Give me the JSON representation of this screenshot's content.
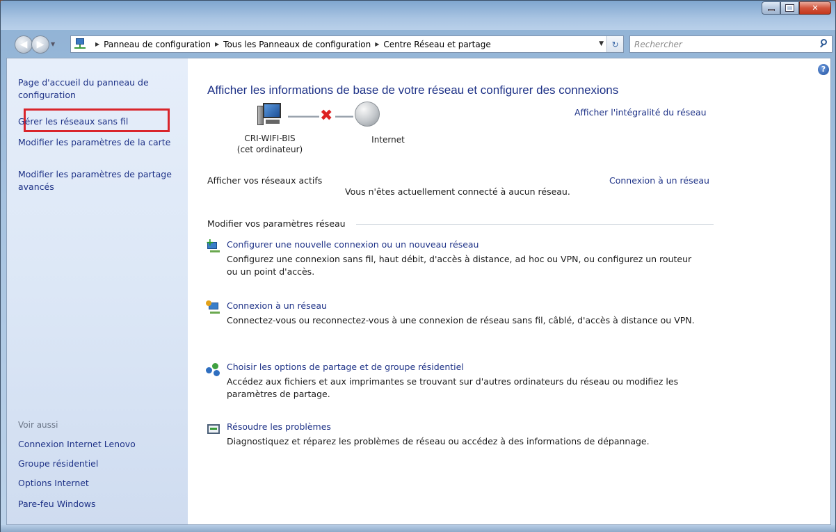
{
  "address": {
    "crumbs": [
      "Panneau de configuration",
      "Tous les Panneaux de configuration",
      "Centre Réseau et partage"
    ],
    "search_placeholder": "Rechercher"
  },
  "sidebar": {
    "home_link": "Page d'accueil du panneau de configuration",
    "links": [
      "Gérer les réseaux sans fil",
      "Modifier les paramètres de la carte",
      "Modifier les paramètres de partage avancés"
    ],
    "see_also_title": "Voir aussi",
    "see_also": [
      "Connexion Internet Lenovo",
      "Groupe résidentiel",
      "Options Internet",
      "Pare-feu Windows"
    ]
  },
  "main": {
    "title": "Afficher les informations de base de votre réseau et configurer des connexions",
    "full_map_link": "Afficher l'intégralité du réseau",
    "computer_name": "CRI-WIFI-BIS",
    "computer_sub": "(cet ordinateur)",
    "internet_label": "Internet",
    "active_networks_label": "Afficher vos réseaux actifs",
    "connect_link": "Connexion à un réseau",
    "not_connected": "Vous n'êtes actuellement connecté à aucun réseau.",
    "change_settings_label": "Modifier vos paramètres réseau",
    "tasks": [
      {
        "title": "Configurer une nouvelle connexion ou un nouveau réseau",
        "desc": "Configurez une connexion sans fil, haut débit, d'accès à distance, ad hoc ou VPN, ou configurez un routeur ou un point d'accès."
      },
      {
        "title": "Connexion à un réseau",
        "desc": "Connectez-vous ou reconnectez-vous à une connexion de réseau sans fil, câblé, d'accès à distance ou VPN."
      },
      {
        "title": "Choisir les options de partage et de groupe résidentiel",
        "desc": "Accédez aux fichiers et aux imprimantes se trouvant sur d'autres ordinateurs du réseau ou modifiez les paramètres de partage."
      },
      {
        "title": "Résoudre les problèmes",
        "desc": "Diagnostiquez et réparez les problèmes de réseau ou accédez à des informations de dépannage."
      }
    ]
  },
  "colors": {
    "link": "#1e3287",
    "highlight": "#d9252b",
    "disconnect": "#dd2222"
  }
}
